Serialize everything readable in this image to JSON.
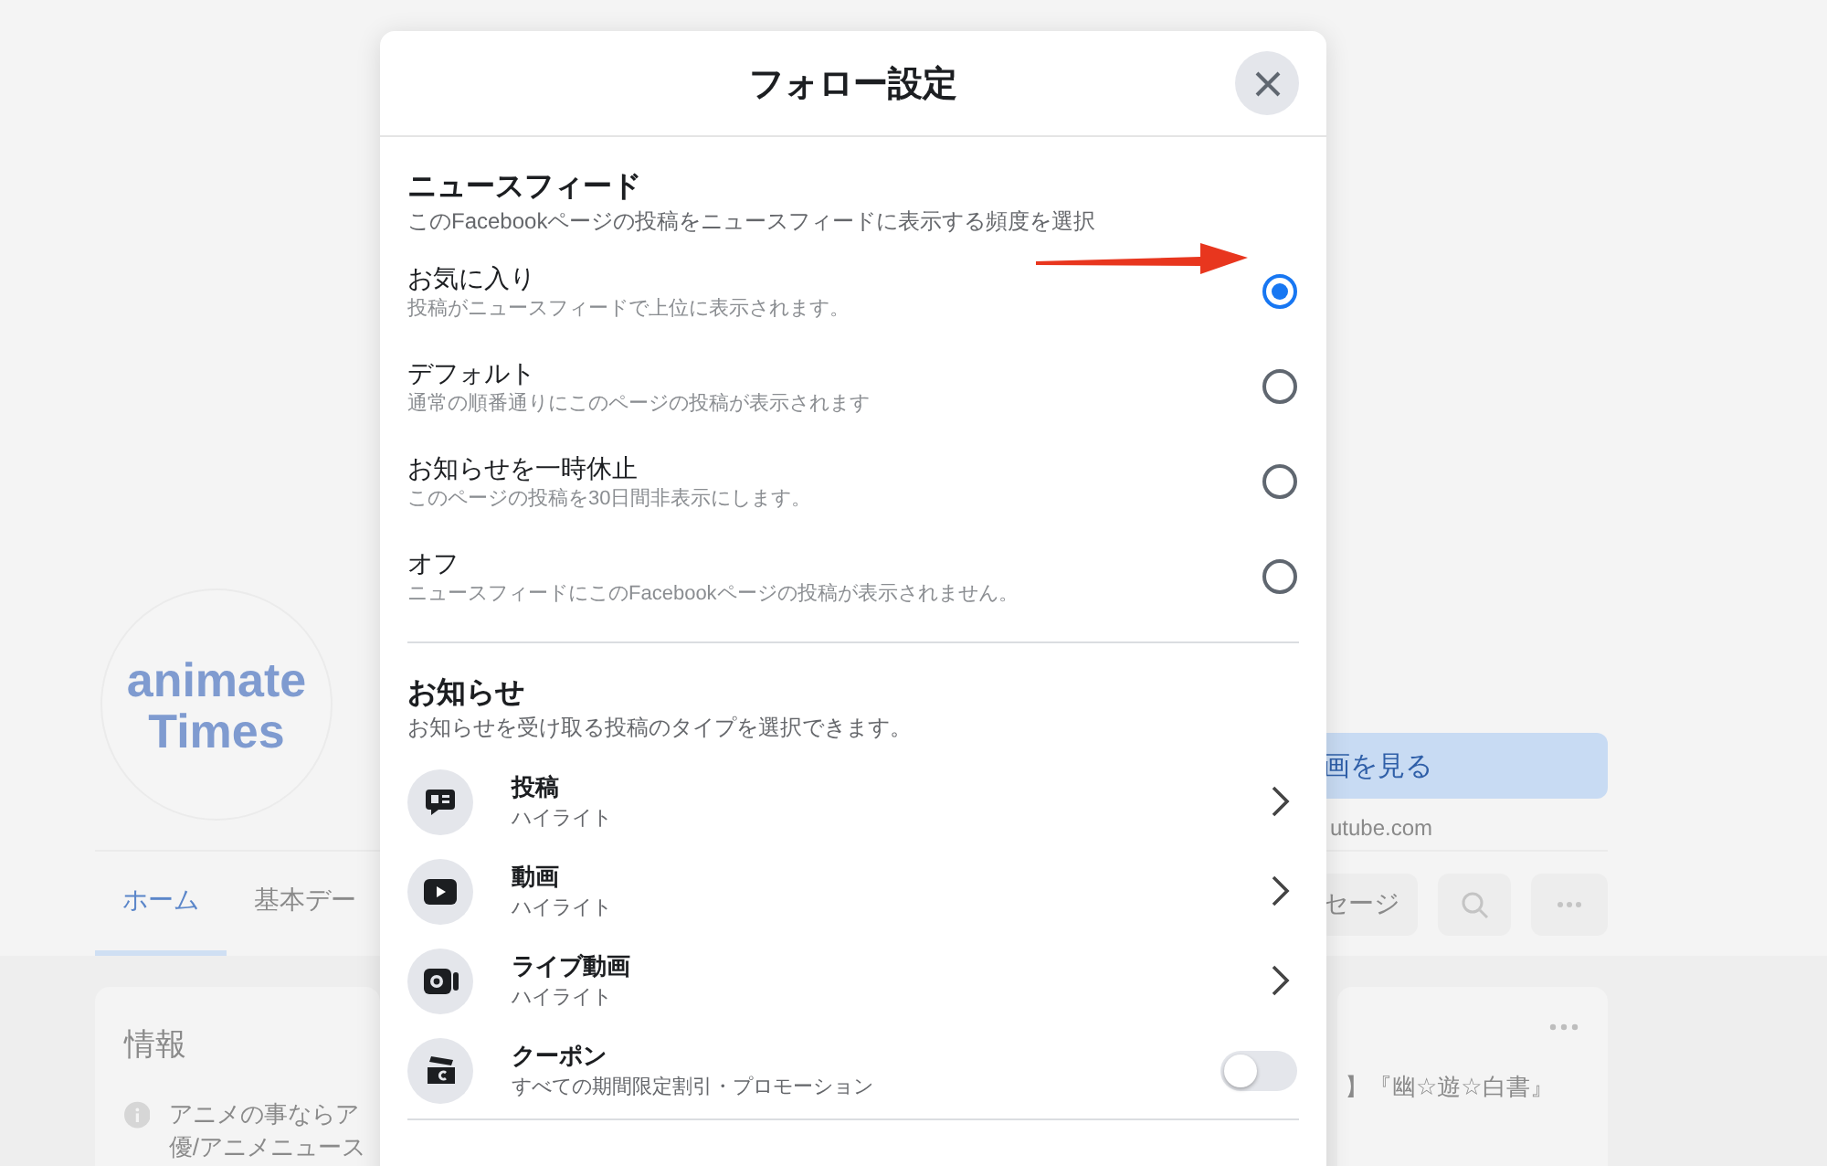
{
  "background_page": {
    "logo": [
      "animate",
      "Times"
    ],
    "cta_button": "画を見る",
    "link": "utube.com",
    "tabs": [
      {
        "label": "ホーム",
        "selected": true
      },
      {
        "label": "基本デー",
        "selected": false
      }
    ],
    "actions": {
      "message": "セージ"
    },
    "info_card": {
      "title": "情報",
      "text_lines": [
        "アニメの事ならア",
        "優/アニメニュース"
      ]
    },
    "post_card": {
      "text": "】『幽☆遊☆白書』"
    }
  },
  "dialog": {
    "title": "フォロー設定",
    "news_feed": {
      "title": "ニュースフィード",
      "description": "このFacebookページの投稿をニュースフィードに表示する頻度を選択",
      "options": [
        {
          "label": "お気に入り",
          "description": "投稿がニュースフィードで上位に表示されます。",
          "selected": true
        },
        {
          "label": "デフォルト",
          "description": "通常の順番通りにこのページの投稿が表示されます",
          "selected": false
        },
        {
          "label": "お知らせを一時休止",
          "description": "このページの投稿を30日間非表示にします。",
          "selected": false
        },
        {
          "label": "オフ",
          "description": "ニュースフィードにこのFacebookページの投稿が表示されません。",
          "selected": false
        }
      ]
    },
    "notifications": {
      "title": "お知らせ",
      "description": "お知らせを受け取る投稿のタイプを選択できます。",
      "items": [
        {
          "kind": "link",
          "label": "投稿",
          "value": "ハイライト"
        },
        {
          "kind": "link",
          "label": "動画",
          "value": "ハイライト"
        },
        {
          "kind": "link",
          "label": "ライブ動画",
          "value": "ハイライト"
        },
        {
          "kind": "toggle",
          "label": "クーポン",
          "value": "すべての期間限定割引・プロモーション",
          "on": false
        }
      ]
    }
  }
}
